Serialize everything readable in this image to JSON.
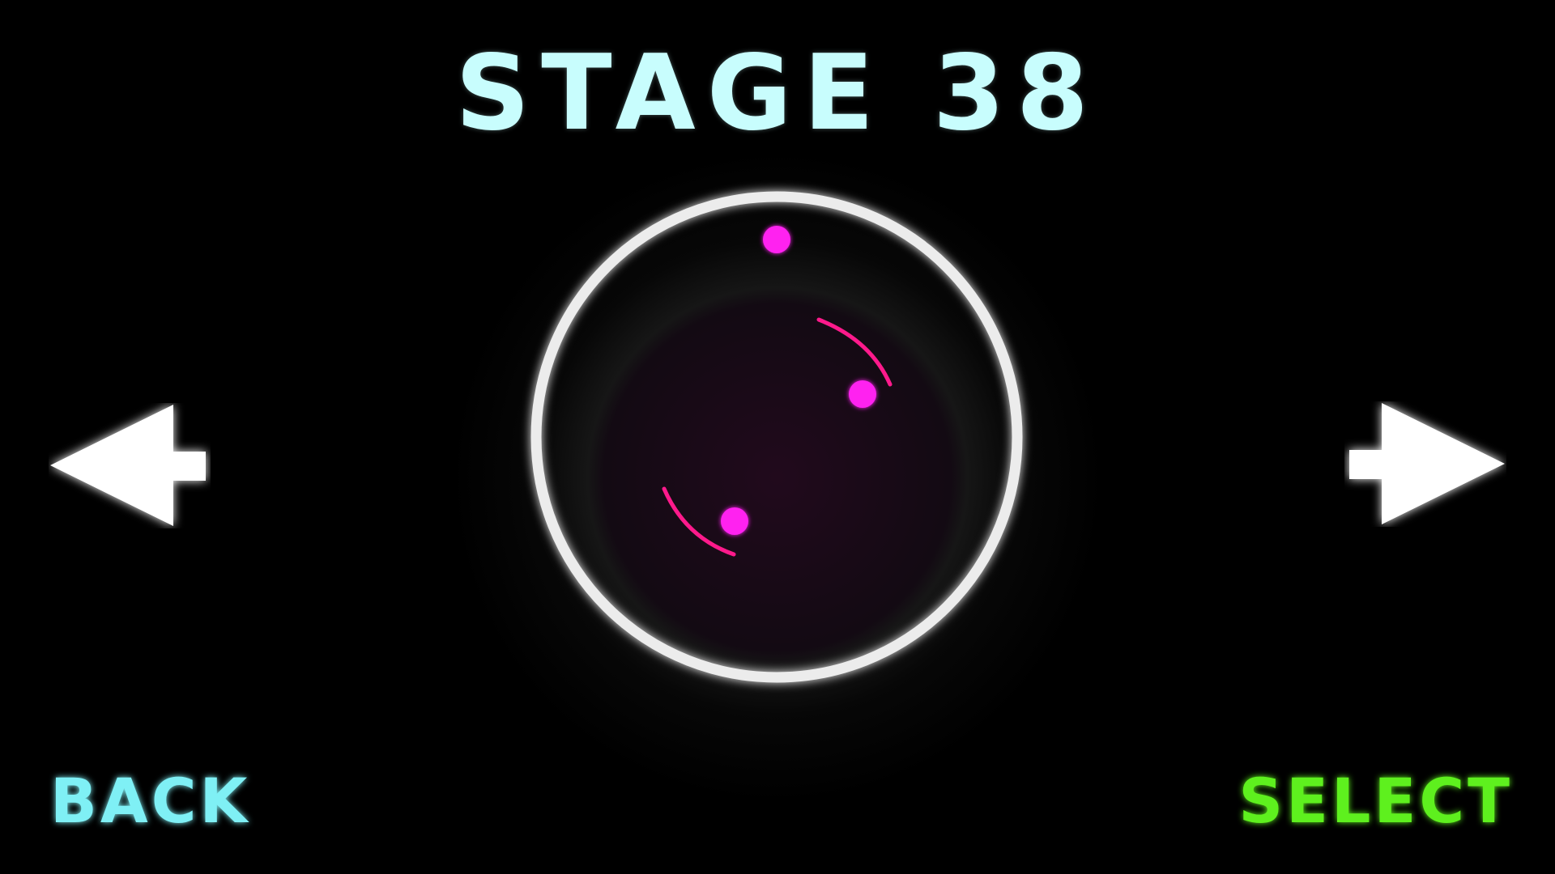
{
  "stage": {
    "title": "STAGE 38"
  },
  "buttons": {
    "back_label": "BACK",
    "select_label": "SELECT"
  },
  "icons": {
    "previous": "arrow-left-icon",
    "next": "arrow-right-icon"
  },
  "colors": {
    "background": "#000000",
    "title": "#c8fdfd",
    "back": "#7ff0f5",
    "select": "#5ef01e",
    "ring": "#ececec",
    "dot": "#ff20f0",
    "arc": "#ff1a8c",
    "arrow": "#ffffff"
  }
}
